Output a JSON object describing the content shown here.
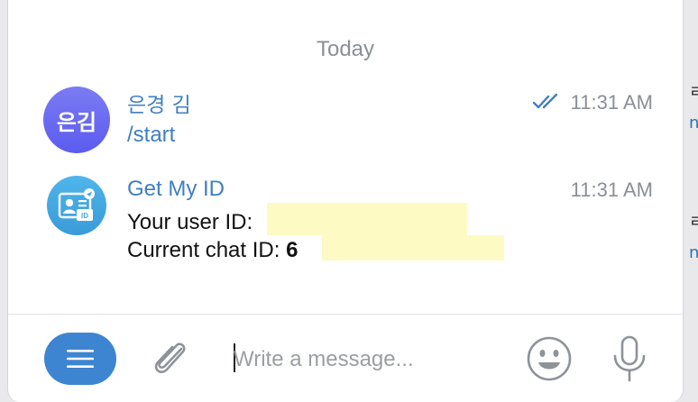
{
  "date_separator": "Today",
  "messages": [
    {
      "avatar_initials": "은김",
      "sender": "은경 김",
      "text": "/start",
      "time": "11:31 AM",
      "read_status": "double-check-icon"
    },
    {
      "avatar_icon": "id-card-icon",
      "sender": "Get My ID",
      "line1_label": "Your user ID:",
      "line2_label": "Current chat ID:",
      "line2_value": "6",
      "time": "11:31 AM"
    }
  ],
  "composer": {
    "placeholder": "Write a message...",
    "menu_icon": "hamburger-icon",
    "attach_icon": "paperclip-icon",
    "emoji_icon": "smiley-icon",
    "mic_icon": "microphone-icon"
  },
  "side_fragments": [
    "ㄹ",
    "n",
    "ㄹ",
    "n"
  ],
  "colors": {
    "accent": "#3d85d0",
    "sender": "#3f7fc1",
    "user_avatar": "#6868f0",
    "bot_avatar": "#45aae3",
    "redaction": "#fdfac4"
  }
}
